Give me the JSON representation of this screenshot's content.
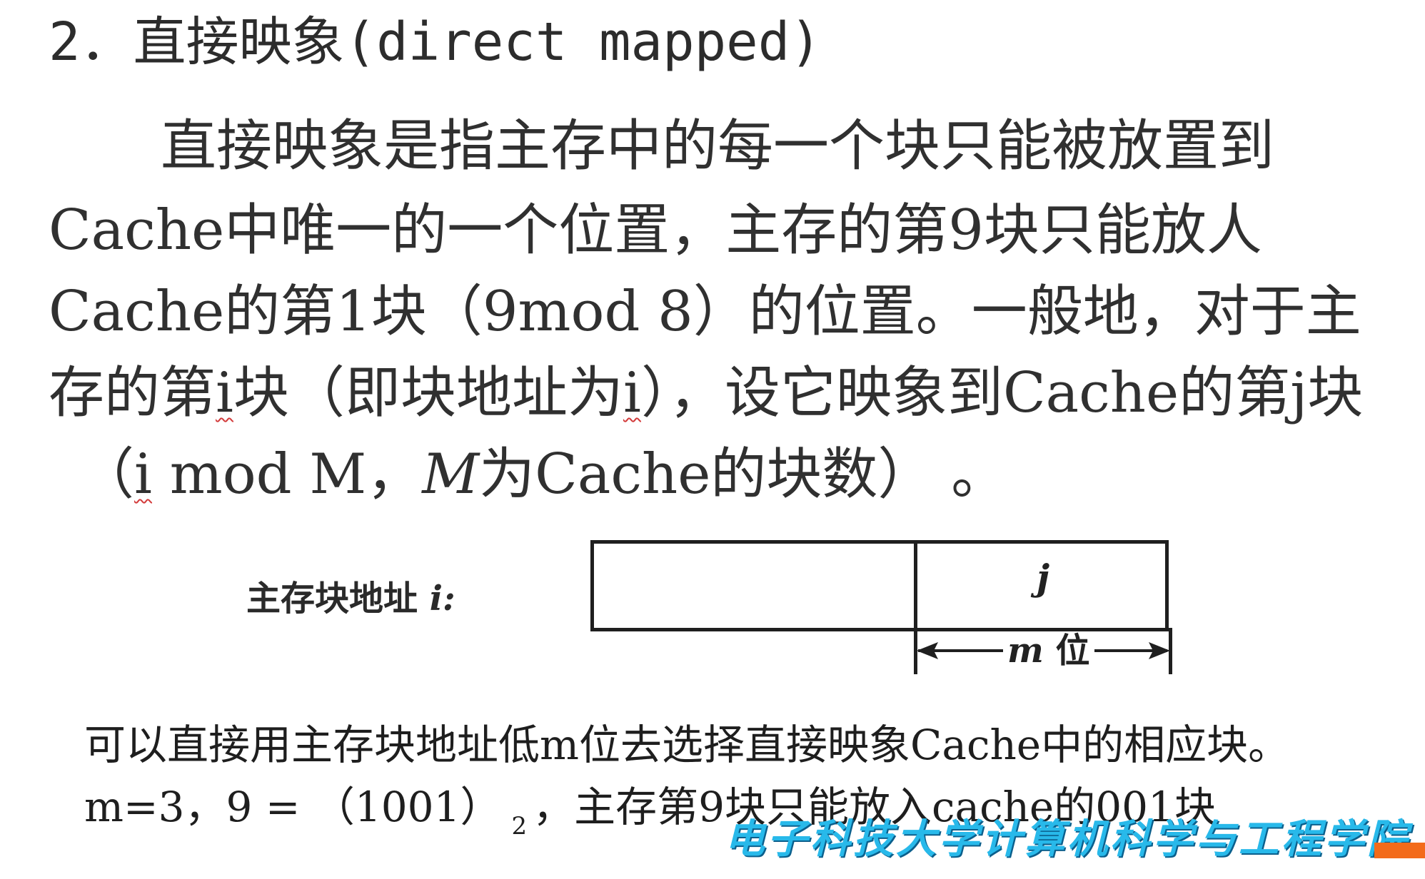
{
  "slide": {
    "section_title": "2．直接映象(direct mapped)",
    "paragraph": {
      "line1": "直接映象是指主存中的每一个块只能被放置到",
      "line2": "Cache中唯一的一个位置，主存的第9块只能放人",
      "line3": "Cache的第1块（9mod 8）的位置。一般地，对于主",
      "line4": {
        "part1": "存的第",
        "i1": "i",
        "part2": "块（即块地址为",
        "i2": "i",
        "part3": "），设它映象到Cache的第j块"
      },
      "line5": {
        "part1": "（",
        "i": "i",
        "part2": " mod M，",
        "m_italic": "M",
        "part3": "为Cache的块数）  。"
      }
    },
    "diagram": {
      "label": "主存块地址 ",
      "label_var": "i:",
      "right_field_label": "j",
      "bits_var": "m",
      "bits_word": " 位"
    },
    "notes": {
      "line1": "可以直接用主存块地址低m位去选择直接映象Cache中的相应块。",
      "line2_prefix": "m=3，9 = （1001）",
      "line2_subscript": "2",
      "line2_suffix": "，主存第9块只能放入cache的001块"
    },
    "watermark": "电子科技大学计算机科学与工程学院",
    "colors": {
      "watermark": "#28b9ea",
      "accent_bar": "#f36b1a"
    }
  }
}
